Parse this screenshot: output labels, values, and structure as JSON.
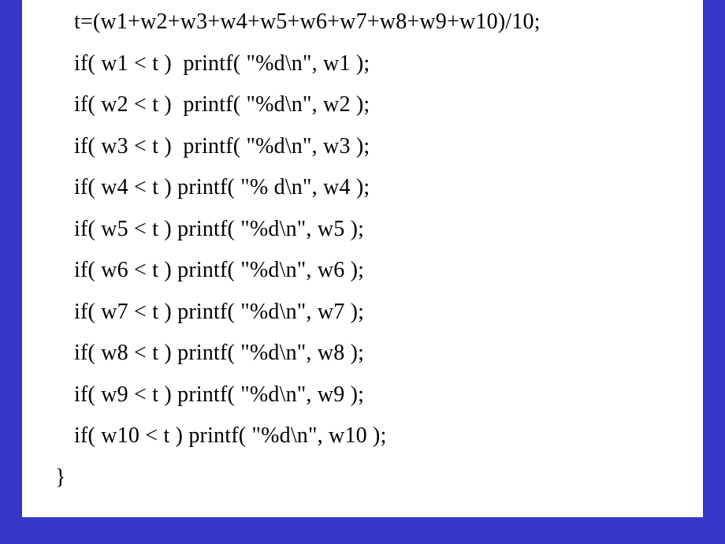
{
  "code": {
    "l1": "t=(w1+w2+w3+w4+w5+w6+w7+w8+w9+w10)/10;",
    "l2": "if( w1 < t )  printf( \"%d\\n\", w1 );",
    "l3": "if( w2 < t )  printf( \"%d\\n\", w2 );",
    "l4": "if( w3 < t )  printf( \"%d\\n\", w3 );",
    "l5": "if( w4 < t ) printf( \"% d\\n\", w4 );",
    "l6": "if( w5 < t ) printf( \"%d\\n\", w5 );",
    "l7": "if( w6 < t ) printf( \"%d\\n\", w6 );",
    "l8": "if( w7 < t ) printf( \"%d\\n\", w7 );",
    "l9": "if( w8 < t ) printf( \"%d\\n\", w8 );",
    "l10": "if( w9 < t ) printf( \"%d\\n\", w9 );",
    "l11": "if( w10 < t ) printf( \"%d\\n\", w10 );",
    "l12": "}"
  }
}
